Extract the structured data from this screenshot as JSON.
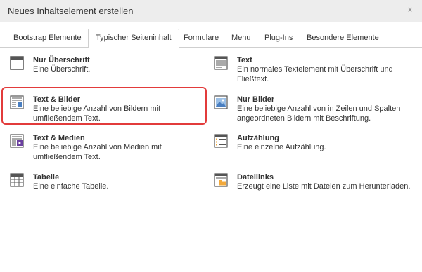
{
  "dialog": {
    "title": "Neues Inhaltselement erstellen",
    "close_glyph": "×"
  },
  "tabs": [
    {
      "label": "Bootstrap Elemente",
      "active": false
    },
    {
      "label": "Typischer Seiteninhalt",
      "active": true
    },
    {
      "label": "Formulare",
      "active": false
    },
    {
      "label": "Menu",
      "active": false
    },
    {
      "label": "Plug-Ins",
      "active": false
    },
    {
      "label": "Besondere Elemente",
      "active": false
    }
  ],
  "items": {
    "header": {
      "title": "Nur Überschrift",
      "desc": "Eine Überschrift.",
      "icon": "header-icon"
    },
    "text": {
      "title": "Text",
      "desc": "Ein normales Textelement mit Überschrift und Fließtext.",
      "icon": "text-icon"
    },
    "textpic": {
      "title": "Text & Bilder",
      "desc": "Eine beliebige Anzahl von Bildern mit umfließendem Text.",
      "icon": "text-image-icon"
    },
    "image": {
      "title": "Nur Bilder",
      "desc": "Eine beliebige Anzahl von in Zeilen und Spalten angeordneten Bildern mit Beschriftung.",
      "icon": "image-icon"
    },
    "textmedia": {
      "title": "Text & Medien",
      "desc": "Eine beliebige Anzahl von Medien mit umfließendem Text.",
      "icon": "text-media-icon"
    },
    "bullets": {
      "title": "Aufzählung",
      "desc": "Eine einzelne Aufzählung.",
      "icon": "list-icon"
    },
    "table": {
      "title": "Tabelle",
      "desc": "Eine einfache Tabelle.",
      "icon": "table-icon"
    },
    "uploads": {
      "title": "Dateilinks",
      "desc": "Erzeugt eine Liste mit Dateien zum Herunterladen.",
      "icon": "file-links-icon"
    }
  },
  "colors": {
    "highlight": "#e23b3b",
    "icon_blue": "#4a7fc1",
    "icon_purple": "#6b3fa0",
    "icon_orange": "#f2a93b"
  }
}
